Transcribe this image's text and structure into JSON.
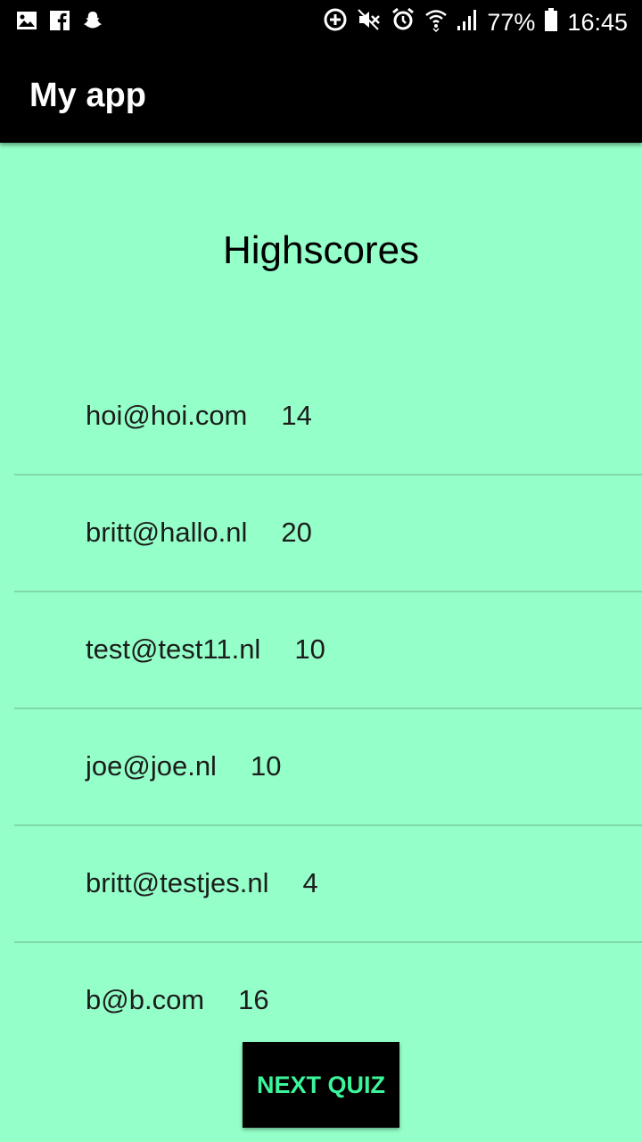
{
  "status_bar": {
    "battery": "77%",
    "time": "16:45",
    "icons_left": [
      "gallery-icon",
      "facebook-icon",
      "snapchat-icon"
    ],
    "icons_right": [
      "data-saver-icon",
      "mute-icon",
      "alarm-icon",
      "wifi-icon",
      "signal-icon",
      "battery-icon"
    ]
  },
  "app_bar": {
    "title": "My app"
  },
  "main": {
    "heading": "Highscores",
    "scores": [
      {
        "email": "hoi@hoi.com",
        "score": "14"
      },
      {
        "email": "britt@hallo.nl",
        "score": "20"
      },
      {
        "email": "test@test11.nl",
        "score": "10"
      },
      {
        "email": "joe@joe.nl",
        "score": "10"
      },
      {
        "email": "britt@testjes.nl",
        "score": "4"
      },
      {
        "email": "b@b.com",
        "score": "16"
      }
    ],
    "next_button": "NEXT QUIZ"
  },
  "colors": {
    "background": "#94ffc8",
    "bar": "#000000",
    "button_text": "#3cf59b",
    "divider": "#7fd9ab"
  }
}
